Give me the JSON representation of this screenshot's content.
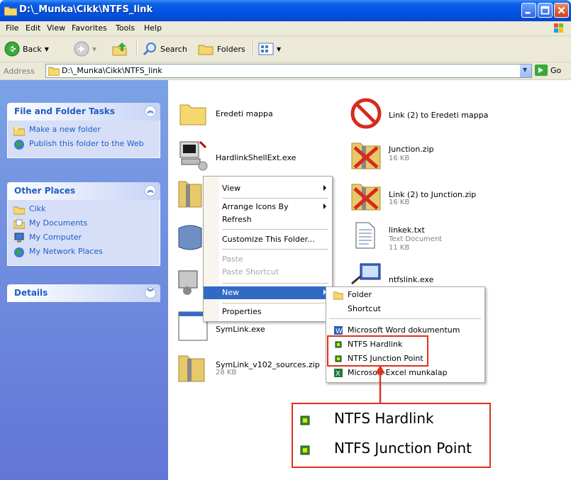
{
  "window": {
    "title": "D:\\_Munka\\Cikk\\NTFS_link"
  },
  "menubar": {
    "items": [
      "File",
      "Edit",
      "View",
      "Favorites",
      "Tools",
      "Help"
    ]
  },
  "toolbar": {
    "back": "Back",
    "search": "Search",
    "folders": "Folders"
  },
  "address": {
    "label": "Address",
    "path": "D:\\_Munka\\Cikk\\NTFS_link",
    "go": "Go"
  },
  "leftpane": {
    "tasks_title": "File and Folder Tasks",
    "tasks": [
      "Make a new folder",
      "Publish this folder to the Web"
    ],
    "places_title": "Other Places",
    "places": [
      "Cikk",
      "My Documents",
      "My Computer",
      "My Network Places"
    ],
    "details_title": "Details"
  },
  "files": {
    "eredeti": {
      "name": "Eredeti mappa"
    },
    "link_eredeti": {
      "name": "Link (2) to Eredeti mappa"
    },
    "hardlinkshell": {
      "name": "HardlinkShellExt.exe"
    },
    "junction": {
      "name": "Junction.zip",
      "sub": "16 KB"
    },
    "link_junction": {
      "name": "Link (2) to Junction.zip",
      "sub": "16 KB"
    },
    "linkek": {
      "name": "linkek.txt",
      "type": "Text Document",
      "size": "11 KB"
    },
    "ntfslink": {
      "name": "ntfslink.exe"
    },
    "symlink": {
      "name": "SymLink.exe"
    },
    "symlink_src": {
      "name": "SymLink_v102_sources.zip",
      "sub": "28 KB"
    }
  },
  "context_menu": {
    "view": "View",
    "arrange": "Arrange Icons By",
    "refresh": "Refresh",
    "customize": "Customize This Folder...",
    "paste": "Paste",
    "paste_shortcut": "Paste Shortcut",
    "new": "New",
    "properties": "Properties"
  },
  "submenu": {
    "folder": "Folder",
    "shortcut": "Shortcut",
    "word": "Microsoft Word dokumentum",
    "hardlink": "NTFS Hardlink",
    "junction": "NTFS Junction Point",
    "excel": "Microsoft Excel munkalap"
  },
  "callout": {
    "hardlink": "NTFS Hardlink",
    "junction": "NTFS Junction Point"
  },
  "colors": {
    "titlebar": "#0054e3",
    "highlight": "#316ac5",
    "callout_border": "#e03020",
    "task_link": "#215dc6"
  }
}
